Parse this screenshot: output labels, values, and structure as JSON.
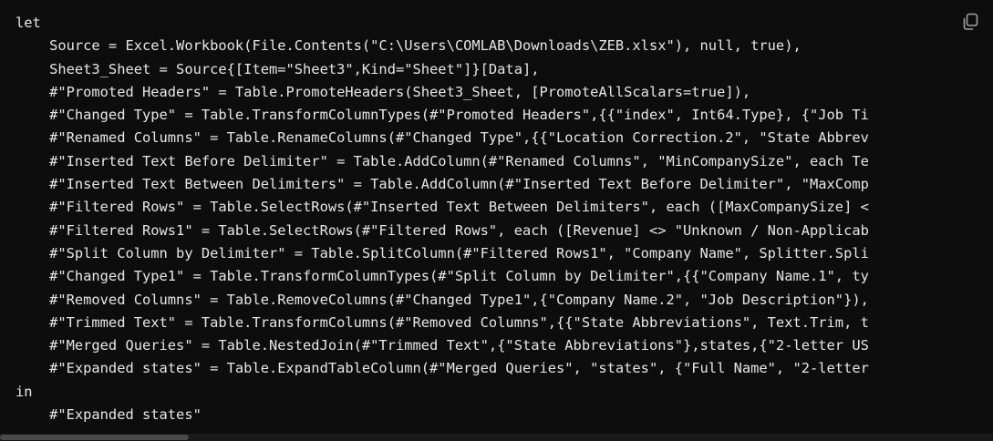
{
  "code": {
    "lines": [
      "let",
      "    Source = Excel.Workbook(File.Contents(\"C:\\Users\\COMLAB\\Downloads\\ZEB.xlsx\"), null, true),",
      "    Sheet3_Sheet = Source{[Item=\"Sheet3\",Kind=\"Sheet\"]}[Data],",
      "    #\"Promoted Headers\" = Table.PromoteHeaders(Sheet3_Sheet, [PromoteAllScalars=true]),",
      "    #\"Changed Type\" = Table.TransformColumnTypes(#\"Promoted Headers\",{{\"index\", Int64.Type}, {\"Job Ti",
      "    #\"Renamed Columns\" = Table.RenameColumns(#\"Changed Type\",{{\"Location Correction.2\", \"State Abbrev",
      "    #\"Inserted Text Before Delimiter\" = Table.AddColumn(#\"Renamed Columns\", \"MinCompanySize\", each Te",
      "    #\"Inserted Text Between Delimiters\" = Table.AddColumn(#\"Inserted Text Before Delimiter\", \"MaxComp",
      "    #\"Filtered Rows\" = Table.SelectRows(#\"Inserted Text Between Delimiters\", each ([MaxCompanySize] <",
      "    #\"Filtered Rows1\" = Table.SelectRows(#\"Filtered Rows\", each ([Revenue] <> \"Unknown / Non-Applicab",
      "    #\"Split Column by Delimiter\" = Table.SplitColumn(#\"Filtered Rows1\", \"Company Name\", Splitter.Spli",
      "    #\"Changed Type1\" = Table.TransformColumnTypes(#\"Split Column by Delimiter\",{{\"Company Name.1\", ty",
      "    #\"Removed Columns\" = Table.RemoveColumns(#\"Changed Type1\",{\"Company Name.2\", \"Job Description\"}),",
      "    #\"Trimmed Text\" = Table.TransformColumns(#\"Removed Columns\",{{\"State Abbreviations\", Text.Trim, t",
      "    #\"Merged Queries\" = Table.NestedJoin(#\"Trimmed Text\",{\"State Abbreviations\"},states,{\"2-letter US",
      "    #\"Expanded states\" = Table.ExpandTableColumn(#\"Merged Queries\", \"states\", {\"Full Name\", \"2-letter",
      "in",
      "    #\"Expanded states\""
    ]
  },
  "toolbar": {
    "copy_icon": "copy-icon"
  },
  "colors": {
    "background": "#0d0d0d",
    "text": "#e6e6e6",
    "icon": "#a0a0a0",
    "scrollbar_thumb": "#4a4a4a"
  },
  "scroll": {
    "horizontal_position": 0.0,
    "visible_fraction": 0.19
  }
}
